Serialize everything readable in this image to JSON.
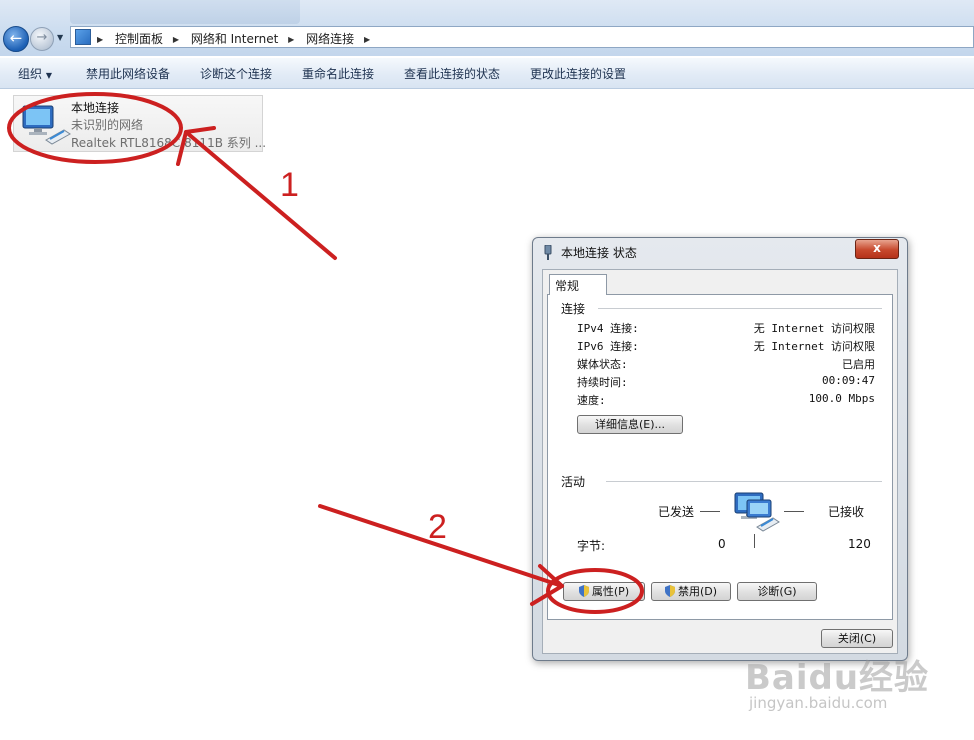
{
  "breadcrumb": {
    "items": [
      "控制面板",
      "网络和 Internet",
      "网络连接"
    ]
  },
  "toolbar": {
    "organize": "组织",
    "disable_device": "禁用此网络设备",
    "diagnose": "诊断这个连接",
    "rename": "重命名此连接",
    "view_status": "查看此连接的状态",
    "change_settings": "更改此连接的设置"
  },
  "connection": {
    "name": "本地连接",
    "status": "未识别的网络",
    "adapter": "Realtek RTL8168C/8111B 系列 ..."
  },
  "dialog": {
    "title": "本地连接 状态",
    "close_glyph": "x",
    "tab": "常规",
    "connection_group": "连接",
    "rows": [
      {
        "label": "IPv4 连接:",
        "value": "无 Internet 访问权限"
      },
      {
        "label": "IPv6 连接:",
        "value": "无 Internet 访问权限"
      },
      {
        "label": "媒体状态:",
        "value": "已启用"
      },
      {
        "label": "持续时间:",
        "value": "00:09:47"
      },
      {
        "label": "速度:",
        "value": "100.0 Mbps"
      }
    ],
    "details_button": "详细信息(E)...",
    "activity_group": "活动",
    "sent_label": "已发送",
    "received_label": "已接收",
    "bytes_label": "字节:",
    "bytes_sent": "0",
    "bytes_received": "120",
    "properties_button": "属性(P)",
    "disable_button": "禁用(D)",
    "diagnose_button": "诊断(G)",
    "close_button": "关闭(C)"
  },
  "annotations": {
    "label_1": "1",
    "label_2": "2",
    "color": "#cc2020"
  },
  "watermark": {
    "brand": "Baidu经验",
    "url": "jingyan.baidu.com"
  }
}
